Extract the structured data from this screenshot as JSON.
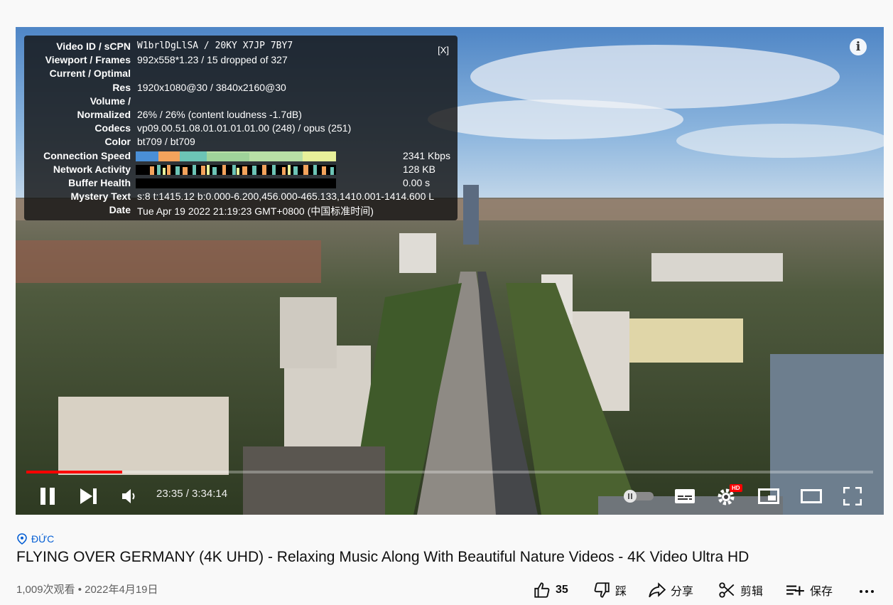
{
  "player": {
    "stats": {
      "close_label": "[X]",
      "rows": [
        {
          "label": "Video ID / sCPN",
          "value": "W1brlDgLlSA / 20KY X7JP 7BY7"
        },
        {
          "label": "Viewport / Frames",
          "value": "992x558*1.23 / 15 dropped of 327"
        },
        {
          "label": "Current / Optimal",
          "value": ""
        },
        {
          "label": "Res",
          "value": "1920x1080@30 / 3840x2160@30"
        },
        {
          "label": "Volume /",
          "value": ""
        },
        {
          "label": "Normalized",
          "value": "26% / 26% (content loudness -1.7dB)"
        },
        {
          "label": "Codecs",
          "value": "vp09.00.51.08.01.01.01.01.00 (248) / opus (251)"
        },
        {
          "label": "Color",
          "value": "bt709 / bt709"
        },
        {
          "label": "Connection Speed",
          "value": "2341 Kbps"
        },
        {
          "label": "Network Activity",
          "value": "128 KB"
        },
        {
          "label": "Buffer Health",
          "value": "0.00 s"
        },
        {
          "label": "Mystery Text",
          "value": "s:8 t:1415.12 b:0.000-6.200,456.000-465.133,1410.001-1414.600 L"
        },
        {
          "label": "Date",
          "value": "Tue Apr 19 2022 21:19:23 GMT+0800 (中国标准时间)"
        }
      ]
    },
    "time_display": "23:35 / 3:34:14",
    "progress_fraction": 0.113,
    "settings_badge": "HD",
    "colors": {
      "progress": "#ff0000",
      "stats_bg": "#141414"
    }
  },
  "video": {
    "location": "ĐỨC",
    "title": "FLYING OVER GERMANY (4K UHD) - Relaxing Music Along With Beautiful Nature Videos - 4K Video Ultra HD",
    "meta": "1,009次观看 • 2022年4月19日"
  },
  "actions": {
    "like_count": "35",
    "dislike_label": "踩",
    "share_label": "分享",
    "clip_label": "剪辑",
    "save_label": "保存"
  },
  "icons": [
    "info-icon",
    "pause-icon",
    "next-icon",
    "volume-icon",
    "autoplay-toggle",
    "captions-icon",
    "settings-icon",
    "miniplayer-icon",
    "theater-icon",
    "fullscreen-icon",
    "location-pin-icon",
    "thumbs-up-icon",
    "thumbs-down-icon",
    "share-icon",
    "scissors-icon",
    "playlist-add-icon",
    "more-icon"
  ]
}
